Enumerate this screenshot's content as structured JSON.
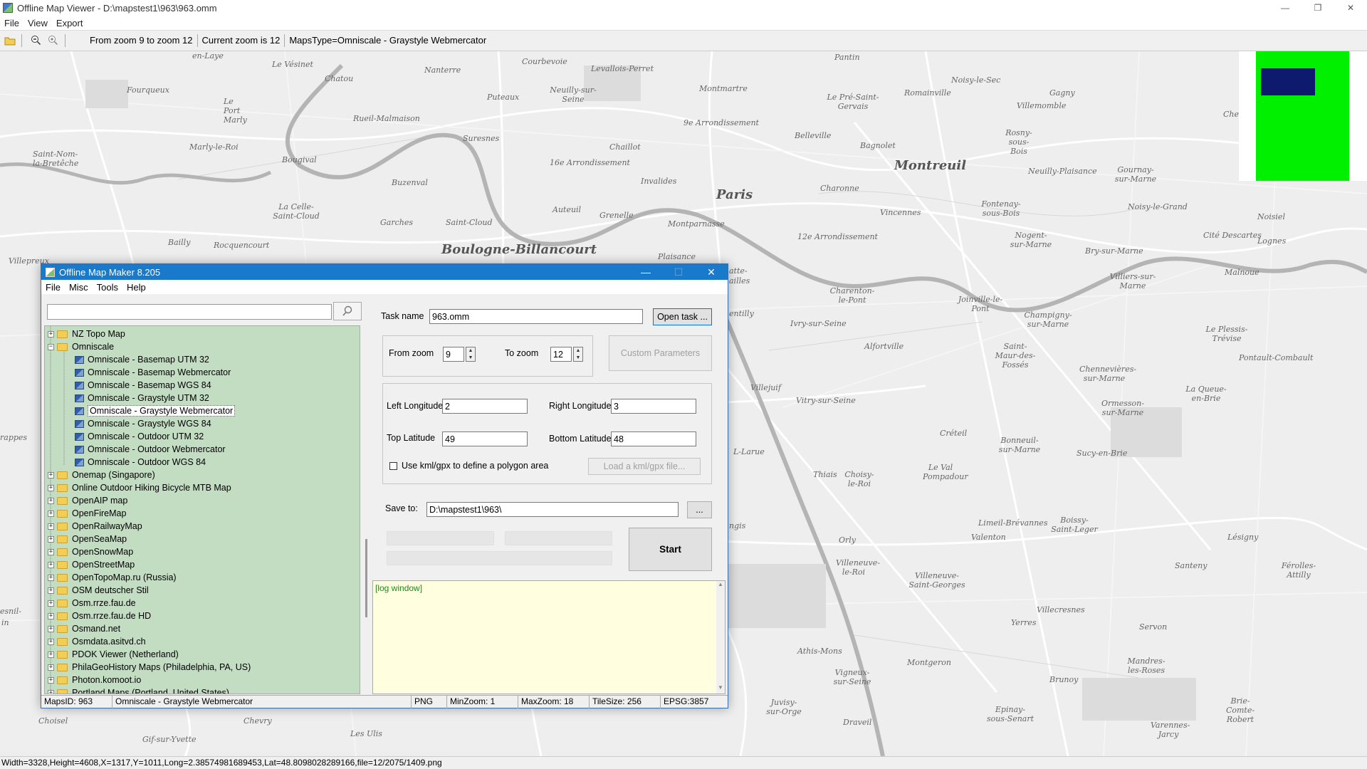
{
  "window": {
    "title": "Offline Map Viewer - D:\\mapstest1\\963\\963.omm",
    "controls": {
      "minimize": "—",
      "restore": "❐",
      "close": "✕"
    }
  },
  "menu": [
    "File",
    "View",
    "Export"
  ],
  "toolbar": {
    "open_icon": "folder-open-icon",
    "zoom_out_icon": "zoom-out-icon",
    "zoom_in_icon": "zoom-in-icon",
    "zoom_range": "From zoom 9 to zoom 12",
    "current_zoom": "Current zoom is 12",
    "maps_type": "MapsType=Omniscale - Graystyle Webmercator"
  },
  "map": {
    "labels": {
      "paris": "Paris",
      "montreuil": "Montreuil",
      "boulogne": "Boulogne-Billancourt",
      "courbevoie": "Courbevoie",
      "levallois": "Levallois-Perret",
      "nanterre": "Nanterre",
      "chatou": "Chatou",
      "le_vesinet": "Le Vésinet",
      "en_laye": "en-Laye",
      "puteaux": "Puteaux",
      "neuilly": "Neuilly-sur-Seine",
      "rueil": "Rueil-Malmaison",
      "fourqueux": "Fourqueux",
      "le_port_marly": "Le Port Marly",
      "marly_le_roi": "Marly-le-Roi",
      "suresnes": "Suresnes",
      "bougival": "Bougival",
      "saint_nom": "Saint-Nom-la-Bretêche",
      "chaillot": "Chaillot",
      "arr16": "16e Arrondissement",
      "invalides": "Invalides",
      "montmartre": "Montmartre",
      "arr9": "9e Arrondissement",
      "pantin": "Pantin",
      "le_pre": "Le Pré-Saint-Gervais",
      "romainville": "Romainville",
      "noisy_le_sec": "Noisy-le-Sec",
      "gagny": "Gagny",
      "villemomble": "Villemomble",
      "belleville": "Belleville",
      "bagnolet": "Bagnolet",
      "rosny": "Rosny-sous-Bois",
      "neuilly_plaisance": "Neuilly-Plaisance",
      "gournay": "Gournay-sur-Marne",
      "charonne": "Charonne",
      "fontenay": "Fontenay-sous-Bois",
      "vincennes": "Vincennes",
      "noisy_le_grand": "Noisy-le-Grand",
      "noisiel": "Noisiel",
      "la_celle": "La Celle-Saint-Cloud",
      "buzenval": "Buzenval",
      "garches": "Garches",
      "saint_cloud": "Saint-Cloud",
      "auteuil": "Auteuil",
      "grenelle": "Grenelle",
      "montparnasse": "Montparnasse",
      "arr12": "12e Arrondissement",
      "nogent": "Nogent-sur-Marne",
      "bry": "Bry-sur-Marne",
      "cite_descartes": "Cité Descartes",
      "lognes": "Lognes",
      "bailly": "Bailly",
      "rocquencourt": "Rocquencourt",
      "villepreux": "Villepreux",
      "plaisance": "Plaisance",
      "charenton": "Charenton-le-Pont",
      "joinville": "Joinville-le-Pont",
      "champigny": "Champigny-sur-Marne",
      "villiers": "Villiers-sur-Marne",
      "malnoue": "Malnoue",
      "le_plessis": "Le Plessis-Trévise",
      "pontault": "Pontault-Combault",
      "ivry": "Ivry-sur-Seine",
      "alfortville": "Alfortville",
      "saint_maur": "Saint-Maur-des-Fossés",
      "chennevieres": "Chennevières-sur-Marne",
      "la_queue": "La Queue-en-Brie",
      "villejuif": "Villejuif",
      "vitry": "Vitry-sur-Seine",
      "creteil": "Créteil",
      "ormesson": "Ormesson-sur-Marne",
      "bonneuil": "Bonneuil-sur-Marne",
      "sucy": "Sucy-en-Brie",
      "thiais": "Thiais",
      "choisy": "Choisy-le-Roi",
      "le_val": "Le Val Pompadour",
      "larue": "L-Larue",
      "orly": "Orly",
      "limeil": "Limeil-Brévannes",
      "boissy": "Boissy-Saint-Leger",
      "valenton": "Valenton",
      "lesigny": "Lésigny",
      "villeneuve_roi": "Villeneuve-le-Roi",
      "villeneuve_sg": "Villeneuve-Saint-Georges",
      "santeny": "Santeny",
      "ferolles": "Férolles-Attilly",
      "villecresnes": "Villecresnes",
      "yerres": "Yerres",
      "servon": "Servon",
      "athis": "Athis-Mons",
      "montgeron": "Montgeron",
      "vigneux": "Vigneux-sur-Seine",
      "brunoy": "Brunoy",
      "mandres": "Mandres-les-Roses",
      "juvisy": "Juvisy-sur-Orge",
      "draveil": "Draveil",
      "epinay": "Epinay-sous-Senart",
      "brie_comte": "Brie-Comte-Robert",
      "varennes": "Varennes-Jarcy",
      "choisel": "Choisel",
      "chevry": "Chevry",
      "les_ulis": "Les Ulis",
      "gif": "Gif-sur-Yvette",
      "trappes": "rappes",
      "esnil": "esnil-",
      "ln": "in",
      "chel": "Chel",
      "lattes": "atte-",
      "ailles": "ailles",
      "entilly": "entilly",
      "ngis": "ngis"
    },
    "overview_colors": {
      "frame": "#00f000",
      "viewport": "#0d1a6e"
    }
  },
  "statusbar": "Width=3328,Height=4608,X=1317,Y=1011,Long=2.38574981689453,Lat=48.8098028289166,file=12/2075/1409.png",
  "dialog": {
    "title": "Offline Map Maker 8.205",
    "menu": [
      "File",
      "Misc",
      "Tools",
      "Help"
    ],
    "search": {
      "value": "",
      "icon": "search-icon"
    },
    "tree": [
      {
        "label": "NZ Topo Map",
        "type": "folder",
        "expanded": false
      },
      {
        "label": "Omniscale",
        "type": "folder",
        "expanded": true
      },
      {
        "label": "Omniscale - Basemap UTM 32",
        "type": "map"
      },
      {
        "label": "Omniscale - Basemap Webmercator",
        "type": "map"
      },
      {
        "label": "Omniscale - Basemap WGS 84",
        "type": "map"
      },
      {
        "label": "Omniscale - Graystyle UTM 32",
        "type": "map"
      },
      {
        "label": "Omniscale - Graystyle Webmercator",
        "type": "map",
        "selected": true
      },
      {
        "label": "Omniscale - Graystyle WGS 84",
        "type": "map"
      },
      {
        "label": "Omniscale - Outdoor UTM 32",
        "type": "map"
      },
      {
        "label": "Omniscale - Outdoor Webmercator",
        "type": "map"
      },
      {
        "label": "Omniscale - Outdoor WGS 84",
        "type": "map"
      },
      {
        "label": "Onemap (Singapore)",
        "type": "folder"
      },
      {
        "label": "Online Outdoor Hiking Bicycle MTB Map",
        "type": "folder"
      },
      {
        "label": "OpenAIP map",
        "type": "folder"
      },
      {
        "label": "OpenFireMap",
        "type": "folder"
      },
      {
        "label": "OpenRailwayMap",
        "type": "folder"
      },
      {
        "label": "OpenSeaMap",
        "type": "folder"
      },
      {
        "label": "OpenSnowMap",
        "type": "folder"
      },
      {
        "label": "OpenStreetMap",
        "type": "folder"
      },
      {
        "label": "OpenTopoMap.ru (Russia)",
        "type": "folder"
      },
      {
        "label": "OSM deutscher Stil",
        "type": "folder"
      },
      {
        "label": "Osm.rrze.fau.de",
        "type": "folder"
      },
      {
        "label": "Osm.rrze.fau.de HD",
        "type": "folder"
      },
      {
        "label": "Osmand.net",
        "type": "folder"
      },
      {
        "label": "Osmdata.asitvd.ch",
        "type": "folder"
      },
      {
        "label": "PDOK Viewer (Netherland)",
        "type": "folder"
      },
      {
        "label": "PhilaGeoHistory Maps (Philadelphia, PA, US)",
        "type": "folder"
      },
      {
        "label": "Photon.komoot.io",
        "type": "folder"
      },
      {
        "label": "Portland Maps (Portland, United States)",
        "type": "folder"
      }
    ],
    "task_name_label": "Task name",
    "task_name_value": "963.omm",
    "open_task_label": "Open task ...",
    "from_zoom_label": "From zoom",
    "from_zoom_value": "9",
    "to_zoom_label": "To zoom",
    "to_zoom_value": "12",
    "custom_params_label": "Custom Parameters",
    "left_lon_label": "Left Longitude",
    "left_lon_value": "2",
    "right_lon_label": "Right Longitude",
    "right_lon_value": "3",
    "top_lat_label": "Top Latitude",
    "top_lat_value": "49",
    "bottom_lat_label": "Bottom Latitude",
    "bottom_lat_value": "48",
    "kml_label": "Use kml/gpx to define a polygon area",
    "load_kml_label": "Load a kml/gpx file...",
    "save_to_label": "Save to:",
    "save_to_value": "D:\\mapstest1\\963\\",
    "browse_label": "...",
    "start_label": "Start",
    "log_text": "[log window]",
    "status": {
      "maps_id": "MapsID: 963",
      "maps_name": "Omniscale - Graystyle Webmercator",
      "format": "PNG",
      "minzoom": "MinZoom: 1",
      "maxzoom": "MaxZoom: 18",
      "tilesize": "TileSize: 256",
      "epsg": "EPSG:3857"
    }
  }
}
